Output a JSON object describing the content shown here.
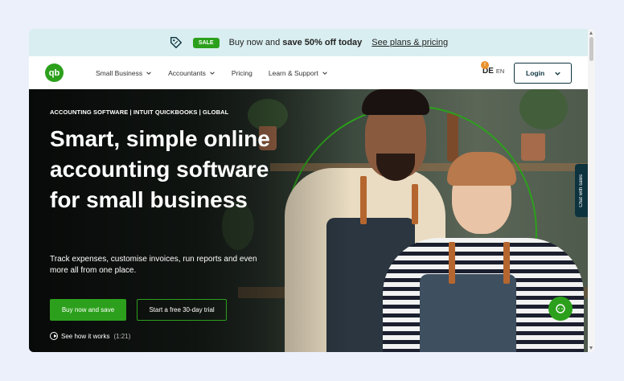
{
  "promo": {
    "badge": "SALE",
    "text_prefix": "Buy now and ",
    "text_bold": "save 50% off today",
    "link": "See plans & pricing"
  },
  "nav": {
    "logo": "qb",
    "items": [
      {
        "label": "Small Business",
        "has_menu": true
      },
      {
        "label": "Accountants",
        "has_menu": true
      },
      {
        "label": "Pricing",
        "has_menu": false
      },
      {
        "label": "Learn & Support",
        "has_menu": true
      }
    ],
    "lang_notice": "!",
    "lang_de": "DE",
    "lang_en": "EN",
    "login": "Login"
  },
  "hero": {
    "eyebrow": "ACCOUNTING SOFTWARE | INTUIT QUICKBOOKS | GLOBAL",
    "headline": "Smart, simple online accounting software for small business",
    "subtext": "Track expenses, customise invoices, run reports and even more all from one place.",
    "primary_cta": "Buy now and save",
    "secondary_cta": "Start a free 30-day trial",
    "video_link": "See how it works",
    "video_duration": "(1:21)"
  },
  "chat": {
    "tab_label": "Chat with sales"
  },
  "colors": {
    "brand_green": "#2ca01c",
    "navy": "#0d333f",
    "promo_bg": "#d9eef0",
    "page_bg": "#ebf0fb"
  }
}
